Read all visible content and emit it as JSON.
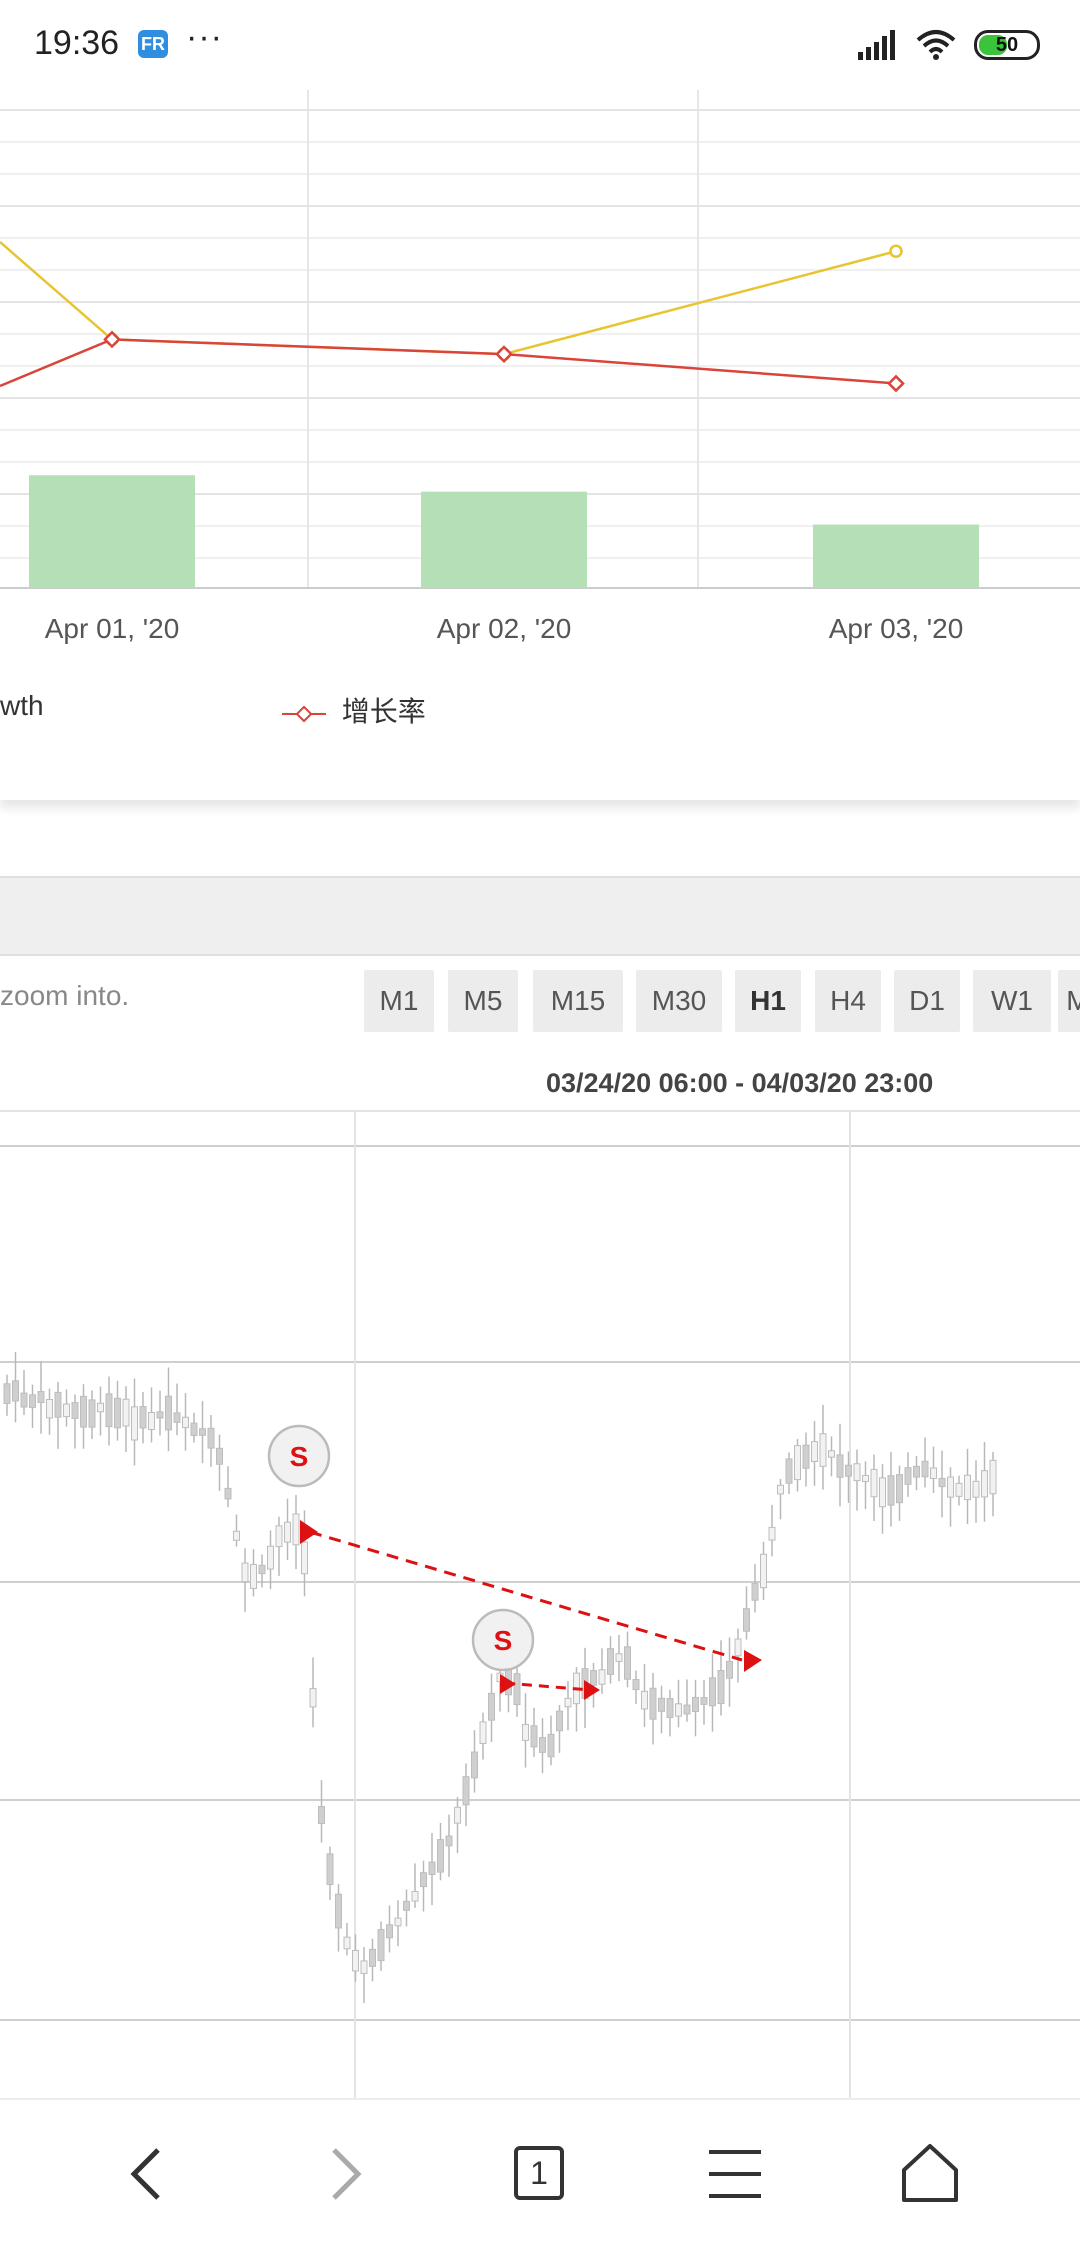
{
  "status_bar": {
    "time": "19:36",
    "app_icon": "FR",
    "dots": "···",
    "battery": "50",
    "battery_level": 0.5,
    "icons": [
      "signal-icon",
      "wifi-icon",
      "battery-icon"
    ]
  },
  "top_chart": {
    "chart_data": {
      "type": "bar+line",
      "categories": [
        "Apr 01, '20",
        "Apr 02, '20",
        "Apr 03, '20"
      ],
      "bars": [
        2.4,
        2.05,
        1.35
      ],
      "series": [
        {
          "name": "",
          "color": "#e8c430",
          "values": [
            5.7,
            5.55,
            6.6
          ]
        },
        {
          "name": "增长率",
          "color": "#d9453b",
          "values": [
            5.7,
            5.55,
            5.25
          ]
        }
      ],
      "bar_color": "#b5dfb5"
    },
    "legend_growth": "wth",
    "legend_rate": "增长率"
  },
  "controls": {
    "zoom_hint": "zoom into.",
    "timeframes": [
      "M1",
      "M5",
      "M15",
      "M30",
      "H1",
      "H4",
      "D1",
      "W1",
      "MN"
    ],
    "active_timeframe": "H1",
    "date_range": "03/24/20 06:00 - 04/03/20 23:00"
  },
  "candle_chart": {
    "signal_label": "S",
    "signal_color": "#dd1111",
    "candle_color": "#cfcfcf"
  },
  "nav": {
    "tab_count": "1",
    "icons": [
      "back-icon",
      "forward-icon",
      "tabs-icon",
      "menu-icon",
      "home-icon"
    ]
  }
}
